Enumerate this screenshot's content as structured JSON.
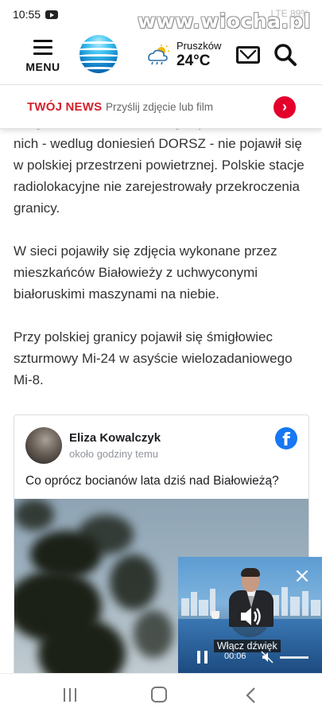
{
  "status_bar": {
    "time": "10:55",
    "right_text": "LTE 89%",
    "watermark": "www.wiocha.pl"
  },
  "header": {
    "menu_label": "MENU",
    "city": "Pruszków",
    "temperature": "24°C"
  },
  "tvn_bar": {
    "title": "TWÓJ NEWS",
    "subtitle": "Przyślij zdjęcie lub film",
    "accent_color": "#d3202b"
  },
  "article": {
    "cut_line": "śmigłowce i statek bezzałogowy. Żaden z",
    "paragraphs": [
      "nich - wedlug doniesień DORSZ - nie pojawił się w polskiej przestrzeni powietrznej. Polskie stacje radiolokacyjne nie zarejestrowały przekroczenia granicy.",
      "W sieci pojawiły się zdjęcia wykonane przez mieszkańców Białowieży z uchwyconymi białoruskimi maszynami na niebie.",
      "Przy polskiej granicy pojawił się śmigłowiec szturmowy Mi-24 w asyście wielozadaniowego Mi-8."
    ]
  },
  "facebook_post": {
    "author": "Eliza Kowalczyk",
    "time": "około godziny temu",
    "text": "Co oprócz bocianów lata dziś nad Białowieżą?",
    "brand_color": "#1877f2"
  },
  "video_player": {
    "enable_sound_label": "Włącz dźwięk",
    "elapsed_time": "00:06"
  }
}
